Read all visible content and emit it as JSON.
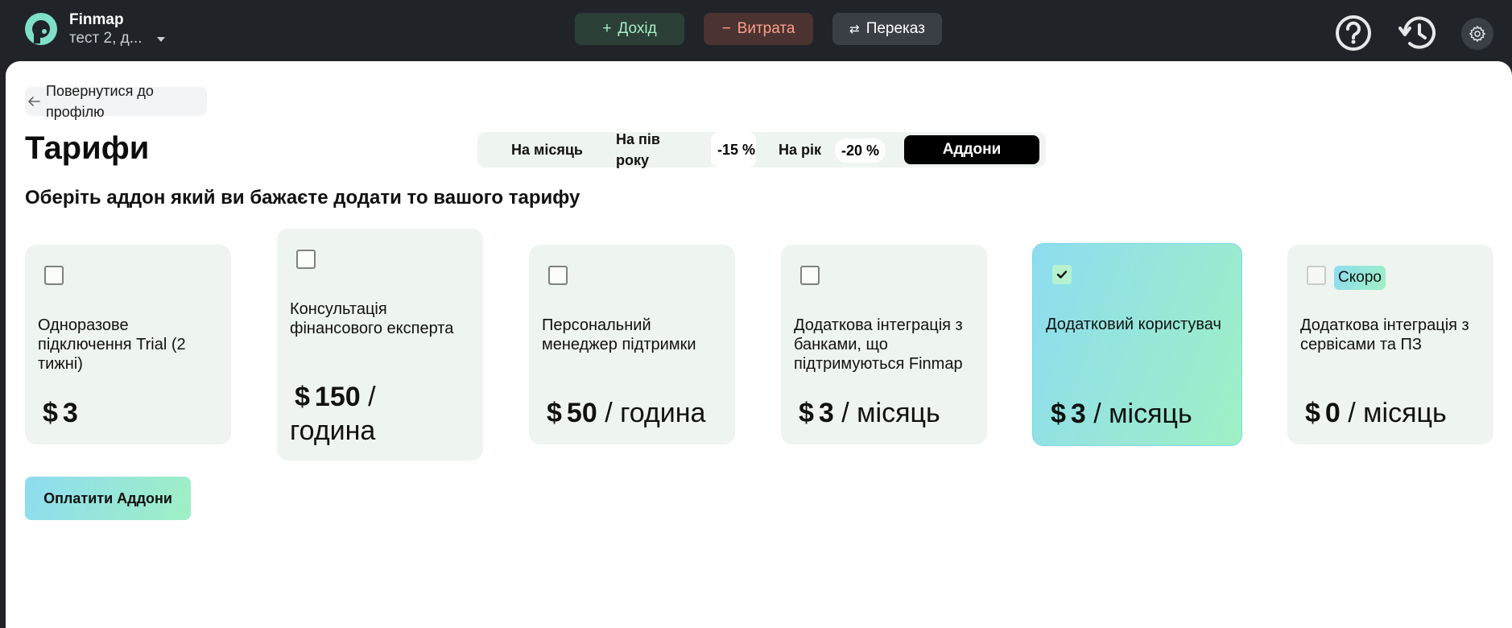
{
  "header": {
    "company_name": "Finmap",
    "company_sub": "тест 2, д...",
    "income_label": "Дохід",
    "expense_label": "Витрата",
    "transfer_label": "Переказ",
    "income_color": "#a6f0c6",
    "expense_color": "#ff9f8a"
  },
  "back_label": "Повернутися до профілю",
  "page_title": "Тарифи",
  "tabs": {
    "month": "На місяць",
    "half_year": "На пів року",
    "half_discount": "-15 %",
    "year": "На рік",
    "year_discount": "-20 %",
    "addons": "Аддони"
  },
  "subtitle": "Оберіть аддон який ви бажаєте додати то вашого тарифу",
  "cards": [
    {
      "title": "Одноразове підключення Trial (2 тижні)",
      "currency": "$",
      "amount": "3",
      "period": "",
      "checked": false
    },
    {
      "title": "Консультація фінансового експерта",
      "currency": "$",
      "amount": "150",
      "period": " / година",
      "checked": false
    },
    {
      "title": "Персональний менеджер підтримки",
      "currency": "$",
      "amount": "50",
      "period": " / година",
      "checked": false
    },
    {
      "title": "Додаткова інтеграція з банками, що підтримуються Finmap",
      "currency": "$",
      "amount": "3",
      "period": " / місяць",
      "checked": false
    },
    {
      "title": "Додатковий користувач",
      "currency": "$",
      "amount": "3",
      "period": " / місяць",
      "checked": true
    },
    {
      "title": "Додаткова інтеграція з сервісами та ПЗ",
      "currency": "$",
      "amount": "0",
      "period": " / місяць",
      "checked": false,
      "badge": "Скоро"
    }
  ],
  "pay_label": "Оплатити Аддони",
  "accent_gradient": [
    "#8ddcf0",
    "#9ff0c4"
  ]
}
